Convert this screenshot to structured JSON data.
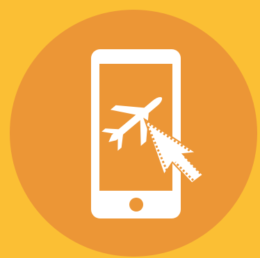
{
  "icon": {
    "name": "mobile-flight-booking-icon",
    "parts": [
      "orange-circle",
      "smartphone-icon",
      "airplane-icon",
      "mouse-cursor-icon"
    ]
  },
  "colors": {
    "background": "#fbbf34",
    "circle": "#ec9636",
    "foreground": "#ffffff"
  }
}
